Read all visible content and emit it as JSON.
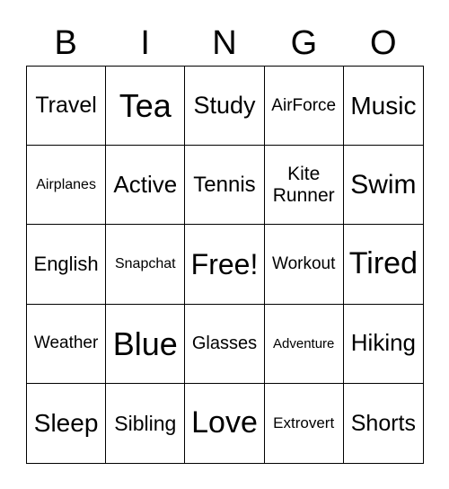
{
  "header": [
    "B",
    "I",
    "N",
    "G",
    "O"
  ],
  "cells": [
    "Travel",
    "Tea",
    "Study",
    "AirForce",
    "Music",
    "Airplanes",
    "Active",
    "Tennis",
    "Kite Runner",
    "Swim",
    "English",
    "Snapchat",
    "Free!",
    "Workout",
    "Tired",
    "Weather",
    "Blue",
    "Glasses",
    "Adventure",
    "Hiking",
    "Sleep",
    "Sibling",
    "Love",
    "Extrovert",
    "Shorts"
  ]
}
